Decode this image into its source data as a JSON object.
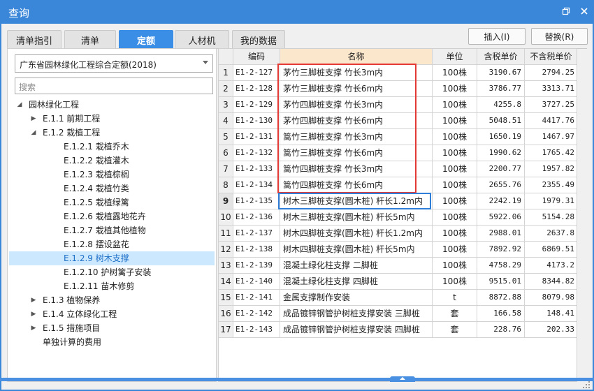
{
  "window": {
    "title": "查询",
    "restore_icon": "restore-icon",
    "close_icon": "close-icon"
  },
  "tabs": [
    {
      "label": "清单指引",
      "active": false
    },
    {
      "label": "清单",
      "active": false
    },
    {
      "label": "定额",
      "active": true
    },
    {
      "label": "人材机",
      "active": false
    },
    {
      "label": "我的数据",
      "active": false
    }
  ],
  "actions": {
    "insert_label": "插入(I)",
    "replace_label": "替换(R)"
  },
  "library": {
    "selected": "广东省园林绿化工程综合定额(2018)",
    "search_placeholder": "搜索"
  },
  "tree": [
    {
      "label": "园林绿化工程",
      "level": 0,
      "state": "expanded",
      "selected": false
    },
    {
      "label": "E.1.1 前期工程",
      "level": 1,
      "state": "collapsed",
      "selected": false
    },
    {
      "label": "E.1.2 栽植工程",
      "level": 1,
      "state": "expanded",
      "selected": false
    },
    {
      "label": "E.1.2.1 栽植乔木",
      "level": 2,
      "state": "leaf",
      "selected": false
    },
    {
      "label": "E.1.2.2 栽植灌木",
      "level": 2,
      "state": "leaf",
      "selected": false
    },
    {
      "label": "E.1.2.3 栽植棕榈",
      "level": 2,
      "state": "leaf",
      "selected": false
    },
    {
      "label": "E.1.2.4 栽植竹类",
      "level": 2,
      "state": "leaf",
      "selected": false
    },
    {
      "label": "E.1.2.5 栽植绿篱",
      "level": 2,
      "state": "leaf",
      "selected": false
    },
    {
      "label": "E.1.2.6 栽植露地花卉",
      "level": 2,
      "state": "leaf",
      "selected": false
    },
    {
      "label": "E.1.2.7 栽植其他植物",
      "level": 2,
      "state": "leaf",
      "selected": false
    },
    {
      "label": "E.1.2.8 摆设盆花",
      "level": 2,
      "state": "leaf",
      "selected": false
    },
    {
      "label": "E.1.2.9 树木支撑",
      "level": 2,
      "state": "leaf",
      "selected": true
    },
    {
      "label": "E.1.2.10 护树篱子安装",
      "level": 2,
      "state": "leaf",
      "selected": false
    },
    {
      "label": "E.1.2.11 苗木修剪",
      "level": 2,
      "state": "leaf",
      "selected": false
    },
    {
      "label": "E.1.3 植物保养",
      "level": 1,
      "state": "collapsed",
      "selected": false
    },
    {
      "label": "E.1.4 立体绿化工程",
      "level": 1,
      "state": "collapsed",
      "selected": false
    },
    {
      "label": "E.1.5 措施项目",
      "level": 1,
      "state": "collapsed",
      "selected": false
    },
    {
      "label": "单独计算的费用",
      "level": 1,
      "state": "leaf",
      "selected": false
    }
  ],
  "grid": {
    "columns": [
      "",
      "编码",
      "名称",
      "单位",
      "含税单价",
      "不含税单价"
    ],
    "current_row": 9,
    "rows": [
      {
        "no": "1",
        "code": "E1-2-127",
        "name": "茅竹三脚桩支撑 竹长3m内",
        "unit": "100株",
        "price_tax": "3190.67",
        "price_notax": "2794.25"
      },
      {
        "no": "2",
        "code": "E1-2-128",
        "name": "茅竹三脚桩支撑 竹长6m内",
        "unit": "100株",
        "price_tax": "3786.77",
        "price_notax": "3313.71"
      },
      {
        "no": "3",
        "code": "E1-2-129",
        "name": "茅竹四脚桩支撑 竹长3m内",
        "unit": "100株",
        "price_tax": "4255.8",
        "price_notax": "3727.25"
      },
      {
        "no": "4",
        "code": "E1-2-130",
        "name": "茅竹四脚桩支撑 竹长6m内",
        "unit": "100株",
        "price_tax": "5048.51",
        "price_notax": "4417.76"
      },
      {
        "no": "5",
        "code": "E1-2-131",
        "name": "篙竹三脚桩支撑 竹长3m内",
        "unit": "100株",
        "price_tax": "1650.19",
        "price_notax": "1467.97"
      },
      {
        "no": "6",
        "code": "E1-2-132",
        "name": "篙竹三脚桩支撑 竹长6m内",
        "unit": "100株",
        "price_tax": "1990.62",
        "price_notax": "1765.42"
      },
      {
        "no": "7",
        "code": "E1-2-133",
        "name": "篙竹四脚桩支撑 竹长3m内",
        "unit": "100株",
        "price_tax": "2200.77",
        "price_notax": "1957.82"
      },
      {
        "no": "8",
        "code": "E1-2-134",
        "name": "篙竹四脚桩支撑 竹长6m内",
        "unit": "100株",
        "price_tax": "2655.76",
        "price_notax": "2355.49"
      },
      {
        "no": "9",
        "code": "E1-2-135",
        "name": "树木三脚桩支撑(圆木桩) 杆长1.2m内",
        "unit": "100株",
        "price_tax": "2242.19",
        "price_notax": "1979.31"
      },
      {
        "no": "10",
        "code": "E1-2-136",
        "name": "树木三脚桩支撑(圆木桩) 杆长5m内",
        "unit": "100株",
        "price_tax": "5922.06",
        "price_notax": "5154.28"
      },
      {
        "no": "11",
        "code": "E1-2-137",
        "name": "树木四脚桩支撑(圆木桩) 杆长1.2m内",
        "unit": "100株",
        "price_tax": "2988.01",
        "price_notax": "2637.8"
      },
      {
        "no": "12",
        "code": "E1-2-138",
        "name": "树木四脚桩支撑(圆木桩) 杆长5m内",
        "unit": "100株",
        "price_tax": "7892.92",
        "price_notax": "6869.51"
      },
      {
        "no": "13",
        "code": "E1-2-139",
        "name": "混凝土绿化柱支撑 二脚桩",
        "unit": "100株",
        "price_tax": "4758.29",
        "price_notax": "4173.2"
      },
      {
        "no": "14",
        "code": "E1-2-140",
        "name": "混凝土绿化柱支撑 四脚桩",
        "unit": "100株",
        "price_tax": "9515.01",
        "price_notax": "8344.82"
      },
      {
        "no": "15",
        "code": "E1-2-141",
        "name": "金属支撑制作安装",
        "unit": "t",
        "price_tax": "8872.88",
        "price_notax": "8079.98"
      },
      {
        "no": "16",
        "code": "E1-2-142",
        "name": "成品镀锌钢管护树桩支撑安装 三脚桩",
        "unit": "套",
        "price_tax": "166.58",
        "price_notax": "148.41"
      },
      {
        "no": "17",
        "code": "E1-2-143",
        "name": "成品镀锌钢管护树桩支撑安装 四脚桩",
        "unit": "套",
        "price_tax": "228.76",
        "price_notax": "202.33"
      }
    ]
  },
  "colors": {
    "titlebar": "#3a86d8",
    "active_tab": "#3a8ee6",
    "highlight_box": "#e53935",
    "focus_box": "#2f7ed8",
    "tree_selected": "#cce8ff"
  }
}
